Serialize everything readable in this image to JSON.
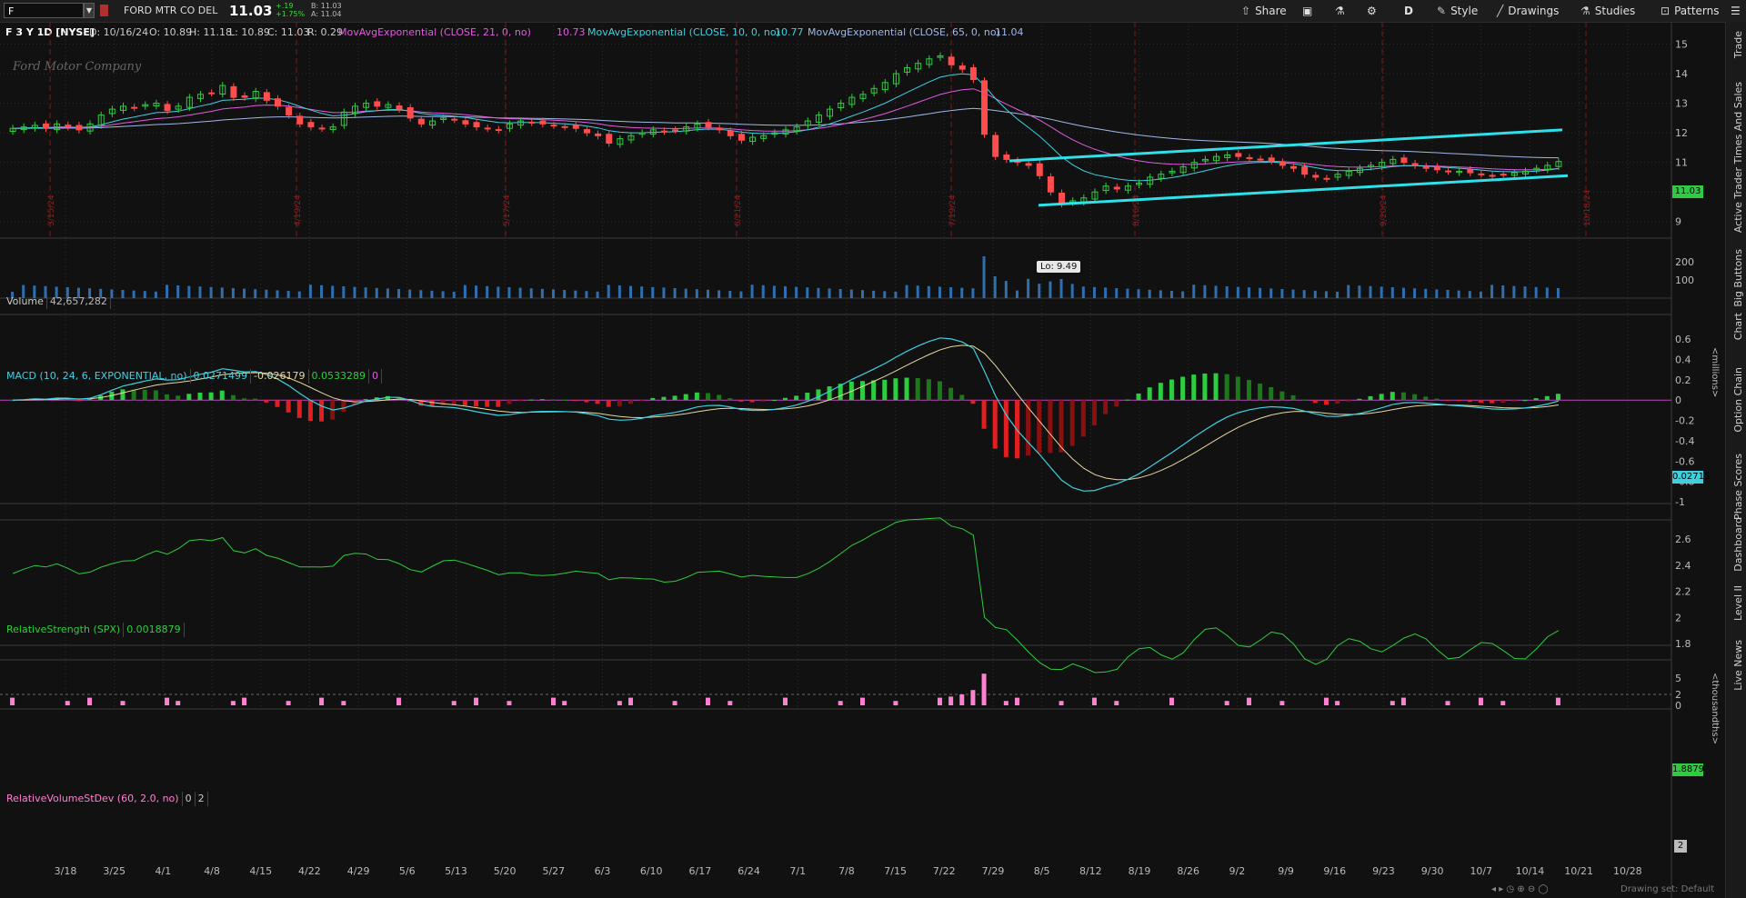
{
  "toolbar": {
    "symbol": "F",
    "company": "FORD MTR CO DEL",
    "last": "11.03",
    "change": "+.19",
    "change_pct": "+1.75%",
    "bid": "B: 11.03",
    "ask": "A: 11.04",
    "buttons": [
      "Share",
      "D",
      "Style",
      "Drawings",
      "Studies",
      "Patterns"
    ]
  },
  "studies": {
    "symbol_desc": "F 3 Y 1D [NYSE]",
    "date": "D: 10/16/24",
    "open": "O: 10.89",
    "high": "H: 11.18",
    "low": "L: 10.89",
    "close": "C: 11.03",
    "range": "R: 0.29",
    "ema21_label": "MovAvgExponential (CLOSE, 21, 0, no)",
    "ema21_val": "10.73",
    "ema10_label": "MovAvgExponential (CLOSE, 10, 0, no)",
    "ema10_val": "10.77",
    "ema65_label": "MovAvgExponential (CLOSE, 65, 0, no)",
    "ema65_val": "11.04"
  },
  "price_pane": {
    "y_ticks": [
      "15",
      "14",
      "13",
      "12",
      "11",
      "10",
      "9"
    ],
    "last_badge": "11.03",
    "low_label": "Lo: 9.49",
    "logo": "Ford Motor Company",
    "earnings_markers": [
      "3/15/24",
      "4/19/24",
      "5/17/24",
      "6/21/24",
      "7/19/24",
      "8/16/24",
      "9/20/24",
      "10/18/24"
    ]
  },
  "volume_pane": {
    "label": "Volume",
    "value": "42,657,282",
    "y_ticks": [
      "200",
      "100"
    ],
    "unit": "<millions>"
  },
  "macd_pane": {
    "label": "MACD (10, 24, 6, EXPONENTIAL, no)",
    "v1": "0.0271499",
    "v2": "-0.026179",
    "v3": "0.0533289",
    "v4": "0",
    "y_ticks": [
      "0.6",
      "0.4",
      "0.2",
      "0",
      "-0.2",
      "-0.4",
      "-0.6",
      "-0.8",
      "-1"
    ],
    "badge": "0.02715"
  },
  "rs_pane": {
    "label": "RelativeStrength (SPX)",
    "value": "0.0018879",
    "y_ticks": [
      "2.6",
      "2.4",
      "2.2",
      "2",
      "1.8"
    ],
    "unit": "<thousandths>",
    "badge": "1.8879"
  },
  "rvsd_pane": {
    "label": "RelativeVolumeStDev (60, 2.0, no)",
    "v1": "0",
    "v2": "2",
    "y_ticks": [
      "5",
      "2",
      "0"
    ],
    "badge": "2"
  },
  "x_axis": [
    "3/18",
    "3/25",
    "4/1",
    "4/8",
    "4/15",
    "4/22",
    "4/29",
    "5/6",
    "5/13",
    "5/20",
    "5/27",
    "6/3",
    "6/10",
    "6/17",
    "6/24",
    "7/1",
    "7/8",
    "7/15",
    "7/22",
    "7/29",
    "8/5",
    "8/12",
    "8/19",
    "8/26",
    "9/2",
    "9/9",
    "9/16",
    "9/23",
    "9/30",
    "10/7",
    "10/14",
    "10/21",
    "10/28"
  ],
  "side_tabs": [
    "Trade",
    "Times And Sales",
    "Active Trader",
    "Big Buttons",
    "Chart",
    "Option Chain",
    "Phase Scores",
    "Dashboard",
    "Level II",
    "Live News"
  ],
  "footer": "Drawing set: Default",
  "colors": {
    "up": "#2ecc40",
    "down": "#ff4d4d",
    "ema21": "#e05ce0",
    "ema10": "#3fd0e0",
    "ema65": "#a0b8e8",
    "trend": "#2fe0e8",
    "volume": "#2d6fb0",
    "macd_line": "#3fd0e0",
    "signal": "#e8d8a0",
    "rs": "#2ecc40",
    "rvsd": "#ff80d0"
  },
  "chart_data": {
    "type": "candlestick",
    "ylim": [
      8.5,
      15.2
    ],
    "ohlc_note": "daily candles, Mar 2024 – Oct 16 2024",
    "closes": [
      12.15,
      12.2,
      12.25,
      12.15,
      12.3,
      12.2,
      12.1,
      12.3,
      12.6,
      12.8,
      12.9,
      12.85,
      12.95,
      13.0,
      12.75,
      12.9,
      13.2,
      13.3,
      13.35,
      13.6,
      13.2,
      13.2,
      13.4,
      13.1,
      12.9,
      12.6,
      12.3,
      12.2,
      12.15,
      12.2,
      12.7,
      12.9,
      13.0,
      12.9,
      12.95,
      12.8,
      12.5,
      12.3,
      12.4,
      12.5,
      12.45,
      12.3,
      12.2,
      12.15,
      12.1,
      12.3,
      12.4,
      12.35,
      12.3,
      12.25,
      12.2,
      12.15,
      12.0,
      11.9,
      11.65,
      11.8,
      11.9,
      12.0,
      12.1,
      12.05,
      12.1,
      12.2,
      12.3,
      12.2,
      12.1,
      11.9,
      11.75,
      11.85,
      11.9,
      12.0,
      12.1,
      12.2,
      12.4,
      12.6,
      12.8,
      13.0,
      13.2,
      13.3,
      13.5,
      13.7,
      14.0,
      14.2,
      14.35,
      14.5,
      14.6,
      14.3,
      14.15,
      13.8,
      11.95,
      11.2,
      11.1,
      11.0,
      10.9,
      10.55,
      10.0,
      9.6,
      9.7,
      9.8,
      10.0,
      10.2,
      10.1,
      10.2,
      10.3,
      10.5,
      10.6,
      10.7,
      10.85,
      11.0,
      11.1,
      11.2,
      11.25,
      11.2,
      11.15,
      11.1,
      11.05,
      10.9,
      10.8,
      10.6,
      10.5,
      10.45,
      10.6,
      10.7,
      10.8,
      10.9,
      11.0,
      11.1,
      11.0,
      10.9,
      10.8,
      10.75,
      10.7,
      10.7,
      10.65,
      10.6,
      10.55,
      10.6,
      10.65,
      10.7,
      10.8,
      10.9,
      11.03
    ],
    "macd_hist_range": [
      -1.0,
      0.7
    ],
    "rs_range": [
      1.8,
      2.65
    ],
    "rvsd_range": [
      0,
      6
    ]
  }
}
